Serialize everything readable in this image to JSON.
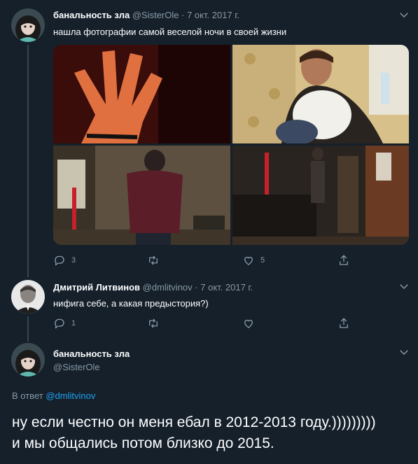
{
  "tweet1": {
    "name": "банальность зла",
    "handle": "@SisterOle",
    "sep": "·",
    "date": "7 окт. 2017 г.",
    "text": "нашла фотографии самой веселой ночи в своей жизни",
    "replies": "3",
    "retweets": "",
    "likes": "5"
  },
  "tweet2": {
    "name": "Дмитрий Литвинов",
    "handle": "@dmlitvinov",
    "sep": "·",
    "date": "7 окт. 2017 г.",
    "text": "нифига себе, а какая предыстория?)",
    "replies": "1",
    "retweets": "",
    "likes": ""
  },
  "tweet3": {
    "name": "банальность зла",
    "handle": "@SisterOle",
    "reply_prefix": "В ответ",
    "reply_handle": "@dmlitvinov",
    "line1": "ну если честно он меня ебал в 2012-2013 году.)))))))))",
    "line2": "и мы общались потом близко до 2015."
  },
  "colors": {
    "background": "#15202b",
    "text": "#ffffff",
    "secondary": "#8899a6",
    "link": "#1da1f2",
    "divider": "#38444d"
  },
  "icons": [
    "reply-icon",
    "retweet-icon",
    "like-icon",
    "share-icon",
    "chevron-down-icon"
  ]
}
